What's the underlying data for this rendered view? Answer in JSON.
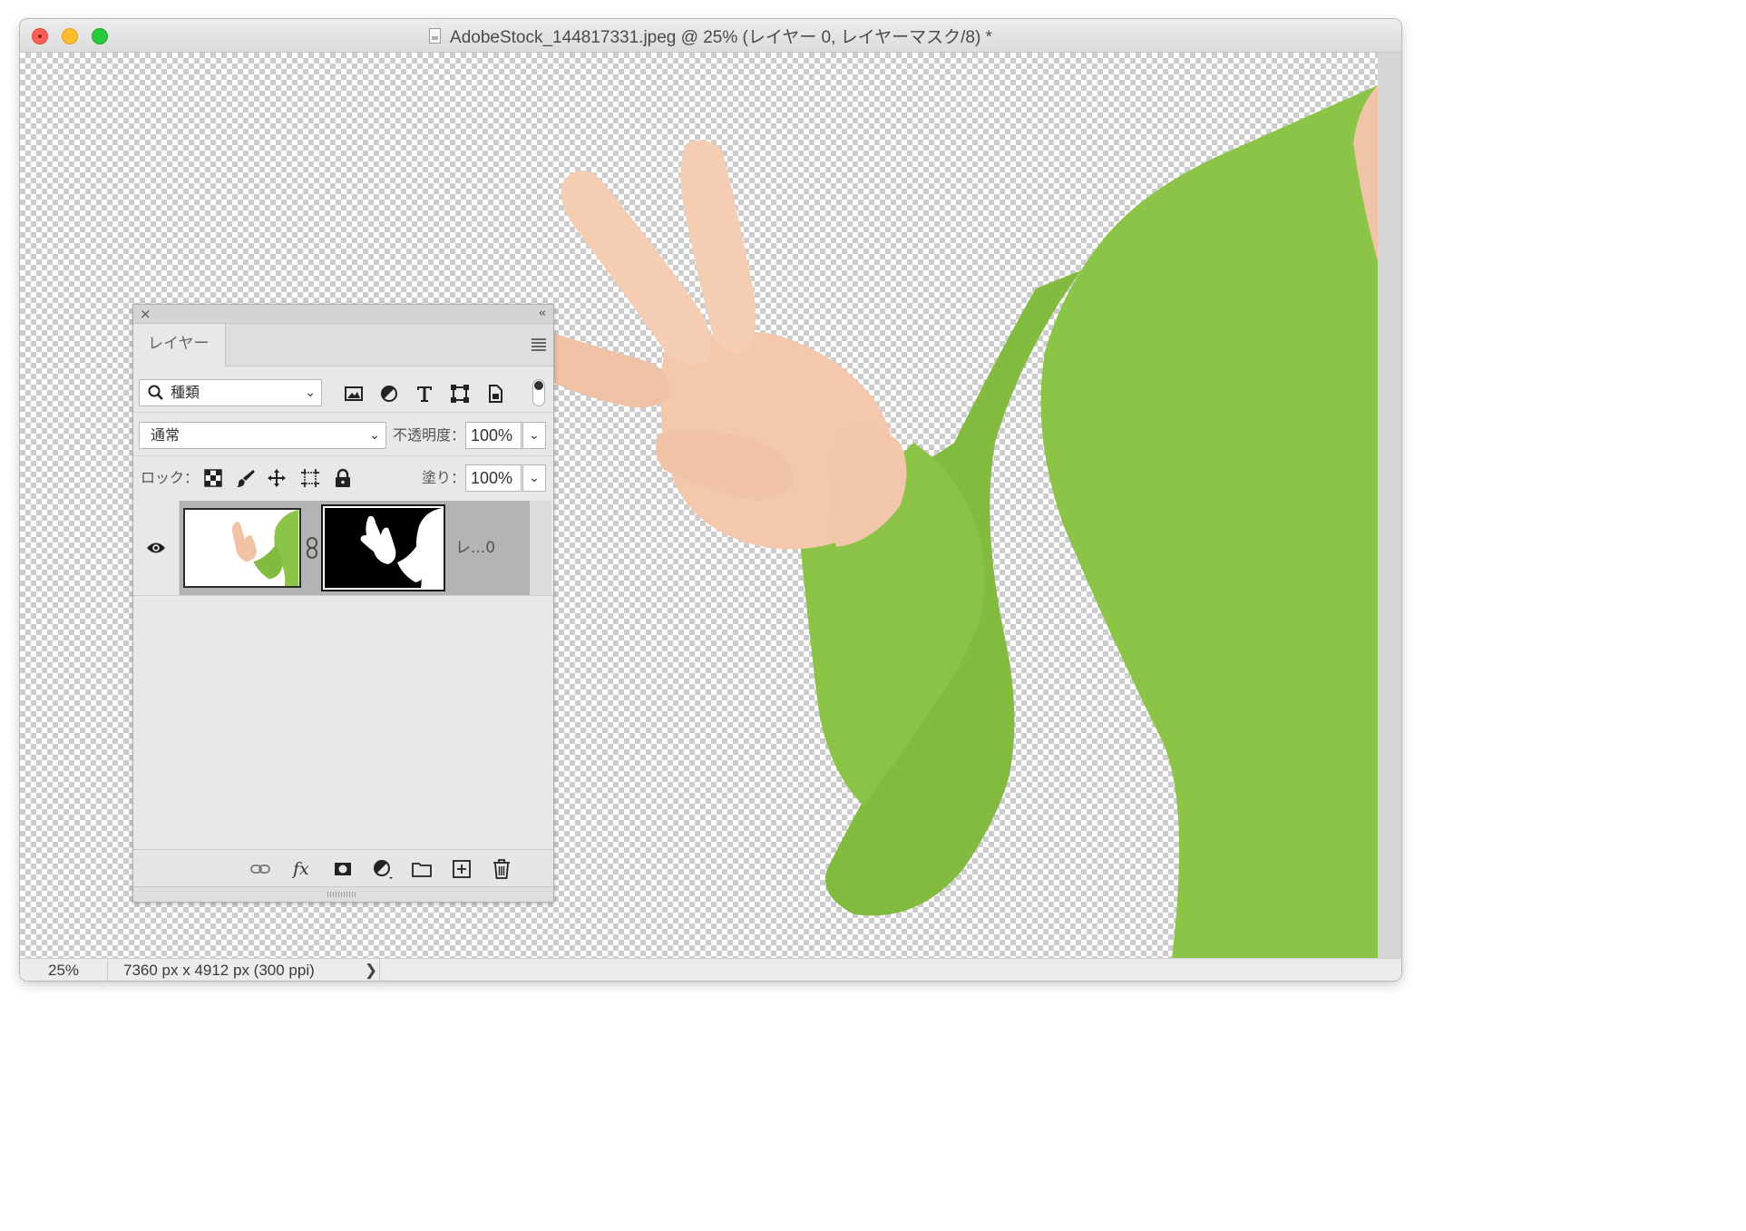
{
  "window": {
    "title": "AdobeStock_144817331.jpeg @ 25% (レイヤー 0, レイヤーマスク/8) *"
  },
  "status_bar": {
    "zoom": "25%",
    "document_size": "7360 px x 4912 px (300 ppi)",
    "arrow": "❯"
  },
  "layers_panel": {
    "close_glyph": "×",
    "collapse_glyph": "‹‹",
    "tab_label": "レイヤー",
    "filter": {
      "kind_value": "種類",
      "icons": [
        "pixel-layer-filter-icon",
        "adjustment-layer-filter-icon",
        "type-layer-filter-icon",
        "shape-layer-filter-icon",
        "smart-object-filter-icon"
      ]
    },
    "blend_mode": "通常",
    "opacity_label": "不透明度：",
    "opacity_value": "100%",
    "lock_label": "ロック：",
    "fill_label": "塗り：",
    "fill_value": "100%",
    "layers": [
      {
        "name": "レ...0",
        "visible": true,
        "has_mask": true
      }
    ],
    "footer_icons": [
      "link-layers-icon",
      "fx-icon",
      "add-mask-icon",
      "adjustment-layer-icon",
      "new-group-icon",
      "new-layer-icon",
      "delete-icon"
    ],
    "fx_text": "fx"
  },
  "colors": {
    "sweater": "#8cc448",
    "skin": "#f3c8ad",
    "selected_row": "#b4b4b4"
  }
}
